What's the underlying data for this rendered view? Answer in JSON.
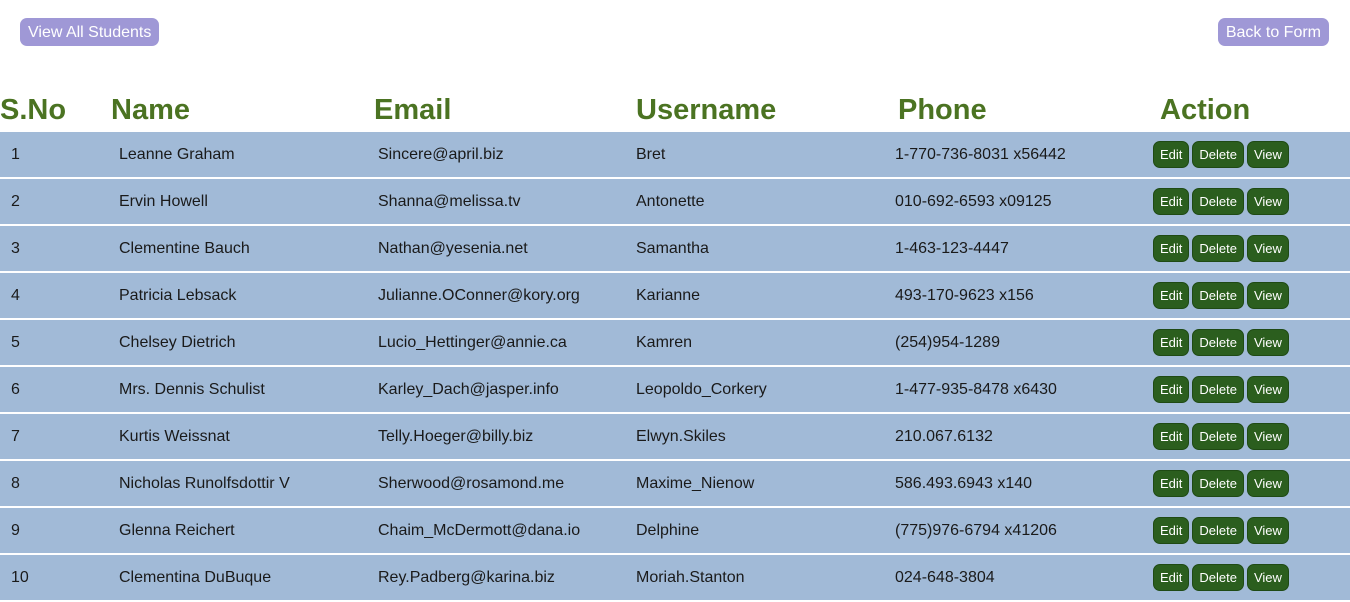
{
  "nav": {
    "view_all_label": "View All Students",
    "back_label": "Back to Form"
  },
  "table": {
    "headers": {
      "sno": "S.No",
      "name": "Name",
      "email": "Email",
      "username": "Username",
      "phone": "Phone",
      "action": "Action"
    },
    "actions": {
      "edit": "Edit",
      "delete": "Delete",
      "view": "View"
    },
    "rows": [
      {
        "sno": "1",
        "name": "Leanne Graham",
        "email": "Sincere@april.biz",
        "username": "Bret",
        "phone": "1-770-736-8031 x56442"
      },
      {
        "sno": "2",
        "name": "Ervin Howell",
        "email": "Shanna@melissa.tv",
        "username": "Antonette",
        "phone": "010-692-6593 x09125"
      },
      {
        "sno": "3",
        "name": "Clementine Bauch",
        "email": "Nathan@yesenia.net",
        "username": "Samantha",
        "phone": "1-463-123-4447"
      },
      {
        "sno": "4",
        "name": "Patricia Lebsack",
        "email": "Julianne.OConner@kory.org",
        "username": "Karianne",
        "phone": "493-170-9623 x156"
      },
      {
        "sno": "5",
        "name": "Chelsey Dietrich",
        "email": "Lucio_Hettinger@annie.ca",
        "username": "Kamren",
        "phone": "(254)954-1289"
      },
      {
        "sno": "6",
        "name": "Mrs. Dennis Schulist",
        "email": "Karley_Dach@jasper.info",
        "username": "Leopoldo_Corkery",
        "phone": "1-477-935-8478 x6430"
      },
      {
        "sno": "7",
        "name": "Kurtis Weissnat",
        "email": "Telly.Hoeger@billy.biz",
        "username": "Elwyn.Skiles",
        "phone": "210.067.6132"
      },
      {
        "sno": "8",
        "name": "Nicholas Runolfsdottir V",
        "email": "Sherwood@rosamond.me",
        "username": "Maxime_Nienow",
        "phone": "586.493.6943 x140"
      },
      {
        "sno": "9",
        "name": "Glenna Reichert",
        "email": "Chaim_McDermott@dana.io",
        "username": "Delphine",
        "phone": "(775)976-6794 x41206"
      },
      {
        "sno": "10",
        "name": "Clementina DuBuque",
        "email": "Rey.Padberg@karina.biz",
        "username": "Moriah.Stanton",
        "phone": "024-648-3804"
      }
    ]
  },
  "colors": {
    "header_text": "#4b7322",
    "row_background": "#a1bad7",
    "nav_button": "#9f98d6",
    "action_button": "#2b5e1e"
  }
}
